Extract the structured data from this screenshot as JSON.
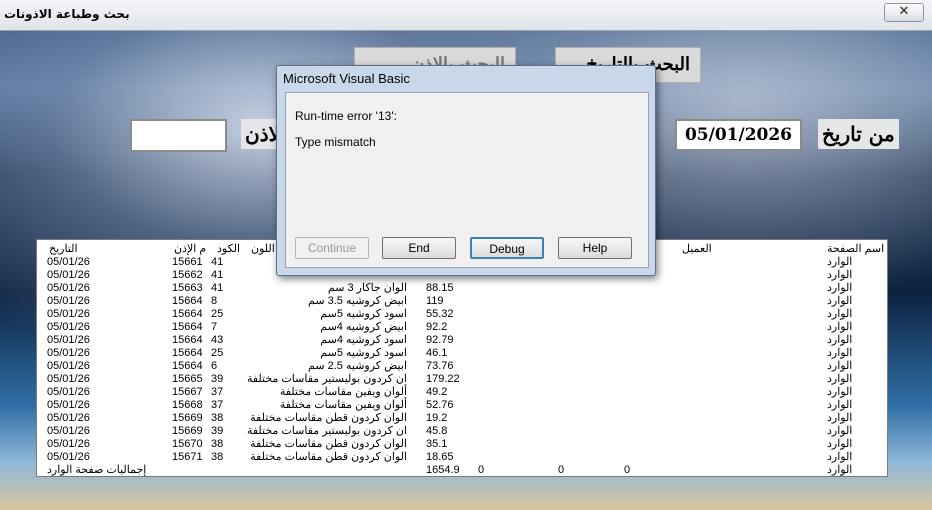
{
  "window": {
    "title": "بحث وطباعة الاذونات",
    "close_glyph": "✕"
  },
  "top_buttons": {
    "by_date": "البحث بالتاريخ",
    "by_permit": "البحث بالإذن"
  },
  "filters": {
    "from_date_label": "من تاريخ",
    "from_date_value": "05/01/2026",
    "permit_label": "الاذن",
    "permit_value": ""
  },
  "list": {
    "headers": {
      "date": "التاريخ",
      "permit_no": "م الإذن",
      "code": "الكود",
      "item": "اللون",
      "customer": "العميل",
      "page_name": "اسم الصفحة"
    },
    "rows": [
      {
        "date": "05/01/26",
        "permit_no": "15661",
        "code": "41",
        "item": "",
        "qty": "",
        "page": "الوارد"
      },
      {
        "date": "05/01/26",
        "permit_no": "15662",
        "code": "41",
        "item": "",
        "qty": "",
        "page": "الوارد"
      },
      {
        "date": "05/01/26",
        "permit_no": "15663",
        "code": "41",
        "item": "الوان جاكار 3 سم",
        "qty": "88.15",
        "page": "الوارد"
      },
      {
        "date": "05/01/26",
        "permit_no": "15664",
        "code": "8",
        "item": "ابيض كروشيه 3.5 سم",
        "qty": "119",
        "page": "الوارد"
      },
      {
        "date": "05/01/26",
        "permit_no": "15664",
        "code": "25",
        "item": "اسود كروشيه 5سم",
        "qty": "55.32",
        "page": "الوارد"
      },
      {
        "date": "05/01/26",
        "permit_no": "15664",
        "code": "7",
        "item": "ابيض كروشيه 4سم",
        "qty": "92.2",
        "page": "الوارد"
      },
      {
        "date": "05/01/26",
        "permit_no": "15664",
        "code": "43",
        "item": "اسود كروشيه 4سم",
        "qty": "92.79",
        "page": "الوارد"
      },
      {
        "date": "05/01/26",
        "permit_no": "15664",
        "code": "25",
        "item": "اسود كروشيه 5سم",
        "qty": "46.1",
        "page": "الوارد"
      },
      {
        "date": "05/01/26",
        "permit_no": "15664",
        "code": "6",
        "item": "ابيض كروشيه 2.5 سم",
        "qty": "73.76",
        "page": "الوارد"
      },
      {
        "date": "05/01/26",
        "permit_no": "15665",
        "code": "39",
        "item": "ان كردون بوليستير مقاسات مختلفة",
        "qty": "179.22",
        "page": "الوارد"
      },
      {
        "date": "05/01/26",
        "permit_no": "15667",
        "code": "37",
        "item": "ألوان ويفين مقاسات مختلفة",
        "qty": "49.2",
        "page": "الوارد"
      },
      {
        "date": "05/01/26",
        "permit_no": "15668",
        "code": "37",
        "item": "ألوان ويفين مقاسات مختلفة",
        "qty": "52.76",
        "page": "الوارد"
      },
      {
        "date": "05/01/26",
        "permit_no": "15669",
        "code": "38",
        "item": "الوان كردون قطن مقاسات مختلفة",
        "qty": "19.2",
        "page": "الوارد"
      },
      {
        "date": "05/01/26",
        "permit_no": "15669",
        "code": "39",
        "item": "ان كردون بوليستير مقاسات مختلفة",
        "qty": "45.8",
        "page": "الوارد"
      },
      {
        "date": "05/01/26",
        "permit_no": "15670",
        "code": "38",
        "item": "الوان كردون قطن مقاسات مختلفة",
        "qty": "35.1",
        "page": "الوارد"
      },
      {
        "date": "05/01/26",
        "permit_no": "15671",
        "code": "38",
        "item": "الوان كردون قطن مقاسات مختلفة",
        "qty": "18.65",
        "page": "الوارد"
      }
    ],
    "totals": {
      "label": "إجماليات صفحة الوارد",
      "qty": "1654.9",
      "a": "0",
      "b": "0",
      "c": "0",
      "page": "الوارد"
    }
  },
  "dialog": {
    "title": "Microsoft Visual Basic",
    "error_line": "Run-time error '13':",
    "message": "Type mismatch",
    "buttons": {
      "continue": "Continue",
      "end": "End",
      "debug": "Debug",
      "help": "Help"
    }
  }
}
